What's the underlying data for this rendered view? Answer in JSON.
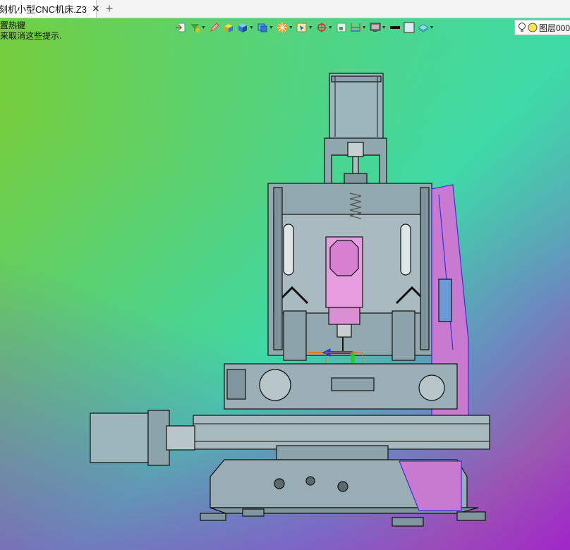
{
  "tabs": [
    {
      "label": "刻机小型CNC机床.Z3",
      "close": "✕"
    }
  ],
  "new_tab_symbol": "+",
  "viewport": {
    "hint_lines": [
      "置热键",
      "来取消这些提示."
    ]
  },
  "toolbar": {
    "buttons": [
      {
        "name": "import-icon",
        "color": "#2f8bd6"
      },
      {
        "name": "filter-icon",
        "color": "#4aa030"
      },
      {
        "name": "pen-icon",
        "color": "#d04a4a"
      },
      {
        "name": "cube-yellow-icon",
        "color": "#e0c020"
      },
      {
        "name": "cube-blue-icon",
        "color": "#2f7ad0"
      },
      {
        "name": "view-cube-icon",
        "color": "#2f7ad0"
      },
      {
        "name": "render-icon",
        "color": "#e07a10"
      },
      {
        "name": "select-icon",
        "color": "#d0a020"
      },
      {
        "name": "target-icon",
        "color": "#d03030"
      },
      {
        "name": "grid-icon",
        "color": "#40a060"
      },
      {
        "name": "dimension-icon",
        "color": "#3060c0"
      },
      {
        "name": "display-icon",
        "color": "#555555"
      },
      {
        "name": "line-color-icon",
        "color": "#111111"
      },
      {
        "name": "fill-color-icon",
        "color": "#dfe9f2"
      },
      {
        "name": "layer-stack-icon",
        "color": "#3aa0c0"
      }
    ],
    "layer": {
      "label": "图层000",
      "bulb_color": "#f2e64a"
    }
  }
}
